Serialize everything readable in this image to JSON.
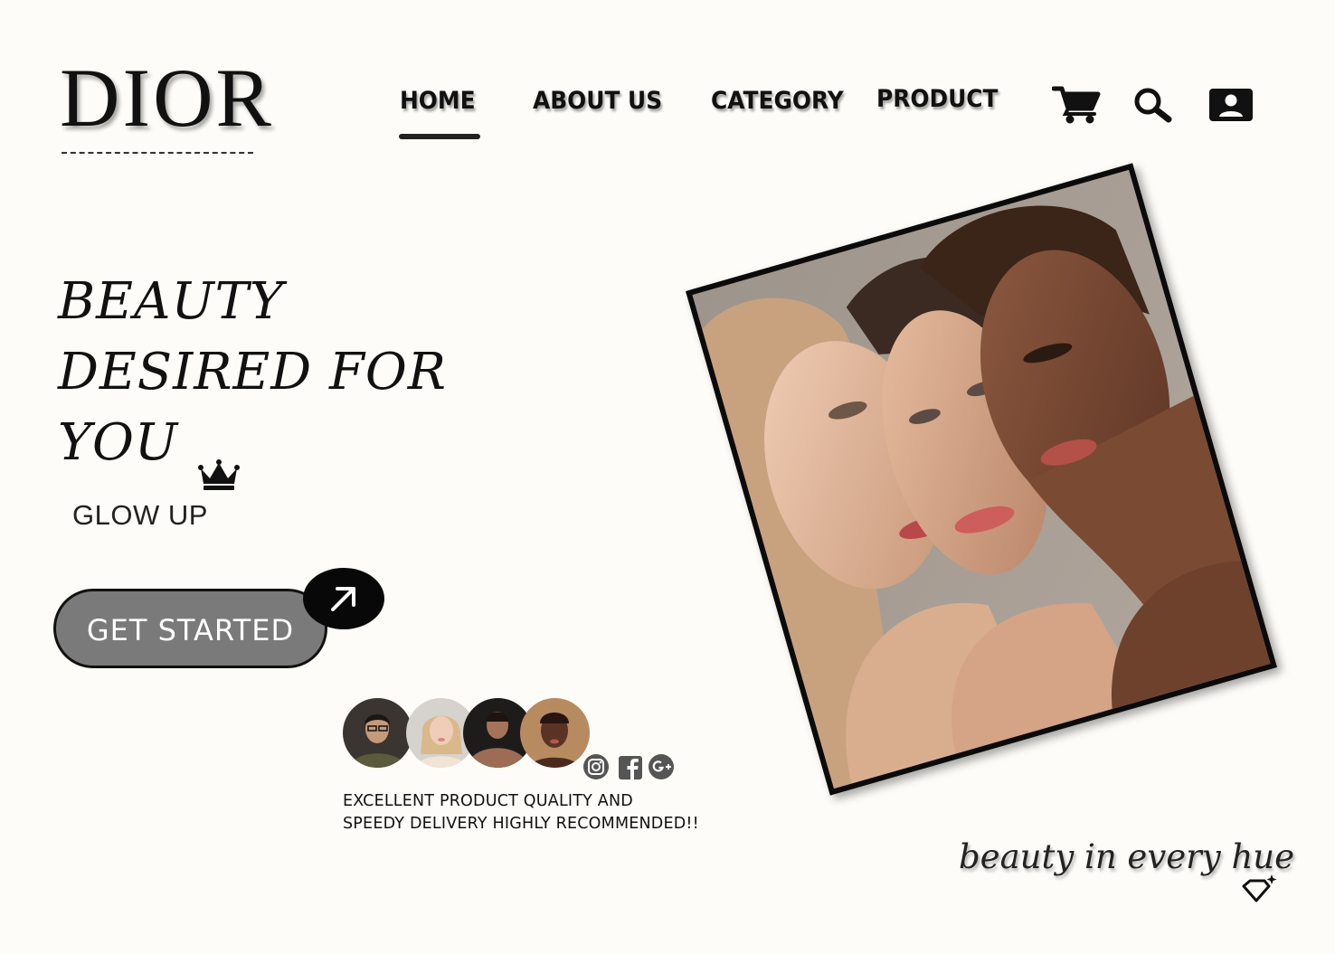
{
  "brand": {
    "logo": "DIOR"
  },
  "nav": {
    "items": [
      {
        "label": "HOME",
        "active": true
      },
      {
        "label": "ABOUT US",
        "active": false
      },
      {
        "label": "CATEGORY",
        "active": false
      },
      {
        "label": "PRODUCT",
        "active": false
      }
    ]
  },
  "header_icons": [
    "cart-icon",
    "search-icon",
    "account-icon"
  ],
  "hero": {
    "title_line1": "BEAUTY",
    "title_line2": "DESIRED FOR",
    "title_line3": "YOU",
    "subtitle": "GLOW UP",
    "cta_label": "GET STARTED"
  },
  "social_proof": {
    "avatars": [
      "avatar-1",
      "avatar-2",
      "avatar-3",
      "avatar-4"
    ],
    "social_icons": [
      "instagram-icon",
      "facebook-icon",
      "google-plus-icon"
    ],
    "review_line1": "EXCELLENT PRODUCT QUALITY AND",
    "review_line2": "SPEEDY DELIVERY HIGHLY RECOMMENDED!!"
  },
  "tagline": "beauty in every hue",
  "colors": {
    "background": "#fdfcf8",
    "cta_fill": "#7a7a7a",
    "dark": "#111111"
  }
}
